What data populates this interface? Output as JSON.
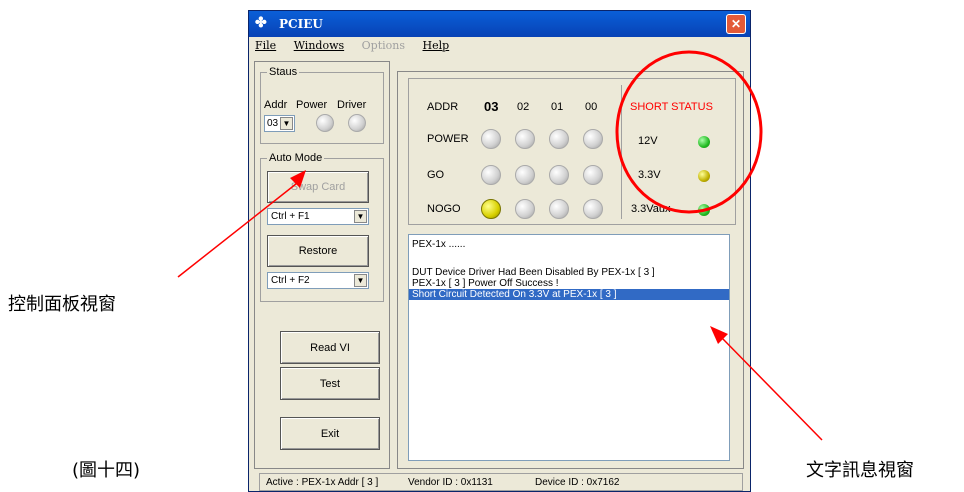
{
  "window": {
    "title": "PCIEU",
    "close_glyph": "✕"
  },
  "menu": {
    "file": "File",
    "windows": "Windows",
    "options": "Options",
    "help": "Help"
  },
  "status_group": {
    "label": "Staus",
    "addr_label": "Addr",
    "power_label": "Power",
    "driver_label": "Driver",
    "addr_value": "03"
  },
  "auto_mode": {
    "label": "Auto Mode",
    "swap_card": "Swap Card",
    "swap_hotkey": "Ctrl + F1",
    "restore": "Restore",
    "restore_hotkey": "Ctrl + F2"
  },
  "buttons": {
    "read_vi": "Read VI",
    "test": "Test",
    "exit": "Exit"
  },
  "grid": {
    "addr_label": "ADDR",
    "columns": [
      "03",
      "02",
      "01",
      "00"
    ],
    "rows": [
      "POWER",
      "GO",
      "NOGO"
    ],
    "nogo_active_index": 0
  },
  "short_status": {
    "title": "SHORT STATUS",
    "title_color": "#ff0000",
    "items": [
      {
        "label": "12V",
        "color": "green"
      },
      {
        "label": "3.3V",
        "color": "olive"
      },
      {
        "label": "3.3Vaux",
        "color": "green"
      }
    ]
  },
  "log": {
    "lines": [
      "PEX-1x ......",
      "",
      "DUT Device Driver Had Been Disabled By PEX-1x [ 3 ]",
      "PEX-1x [ 3 ] Power Off Success !",
      "Short Circuit Detected On 3.3V at PEX-1x [ 3 ]"
    ],
    "selected_index": 4
  },
  "statusbar": {
    "active": "Active :  PEX-1x Addr [ 3 ]",
    "vendor": "Vendor ID : 0x1131",
    "device": "Device ID : 0x7162"
  },
  "annotations": {
    "left_label": "控制面板視窗",
    "right_label": "文字訊息視窗",
    "figure_caption": "(圖十四)",
    "arrow_color": "#ff0000"
  }
}
